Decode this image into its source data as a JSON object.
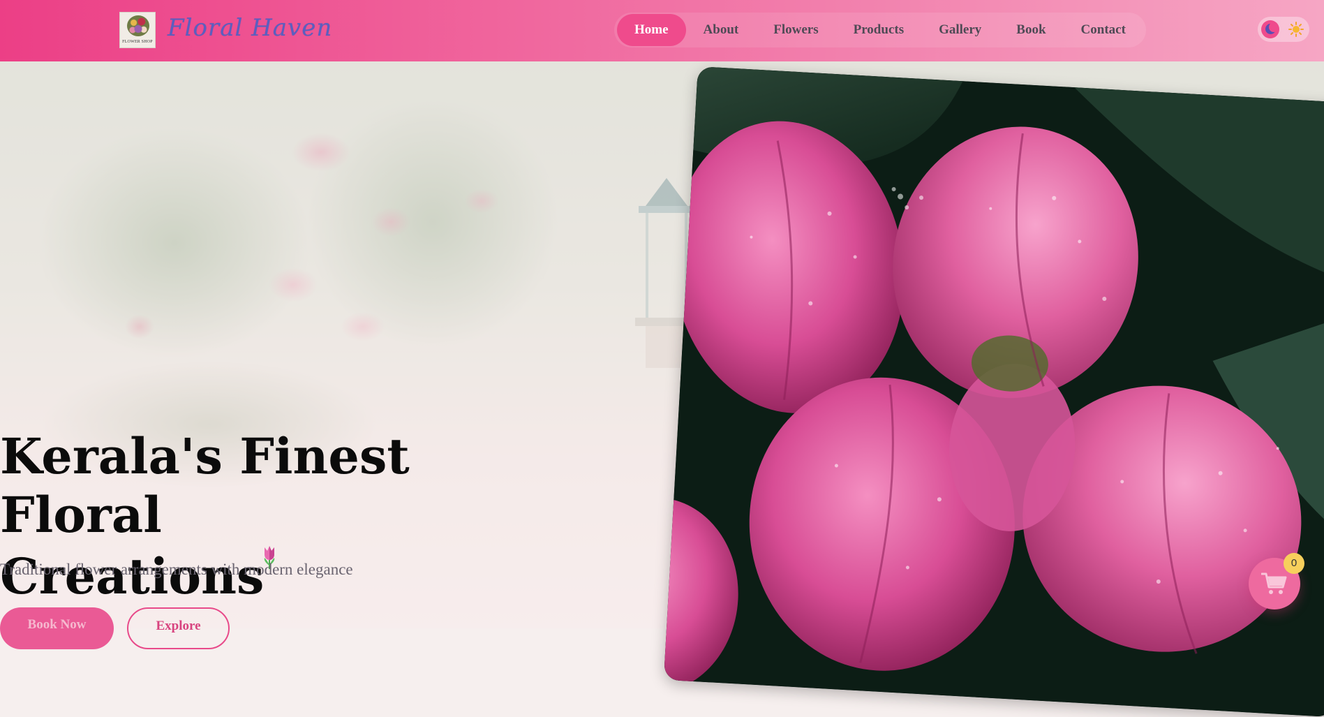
{
  "brand": {
    "name": "Floral Haven",
    "logo_caption": "FLOWER SHOP"
  },
  "nav": {
    "items": [
      {
        "label": "Home",
        "active": true
      },
      {
        "label": "About",
        "active": false
      },
      {
        "label": "Flowers",
        "active": false
      },
      {
        "label": "Products",
        "active": false
      },
      {
        "label": "Gallery",
        "active": false
      },
      {
        "label": "Book",
        "active": false
      },
      {
        "label": "Contact",
        "active": false
      }
    ]
  },
  "theme_toggle": {
    "icons": [
      "moon-icon",
      "sun-icon"
    ]
  },
  "hero": {
    "title_line1": "Kerala's Finest Floral",
    "title_line2": "Creations",
    "title_icon": "tulip-icon",
    "subtitle": "Traditional flower arrangements with modern elegance",
    "primary_button": "Book Now",
    "secondary_button": "Explore"
  },
  "cart": {
    "icon": "cart-icon",
    "count": "0"
  },
  "colors": {
    "accent": "#ef4b8c",
    "brand_text": "#5a5fc0",
    "badge": "#f7cf5c"
  }
}
